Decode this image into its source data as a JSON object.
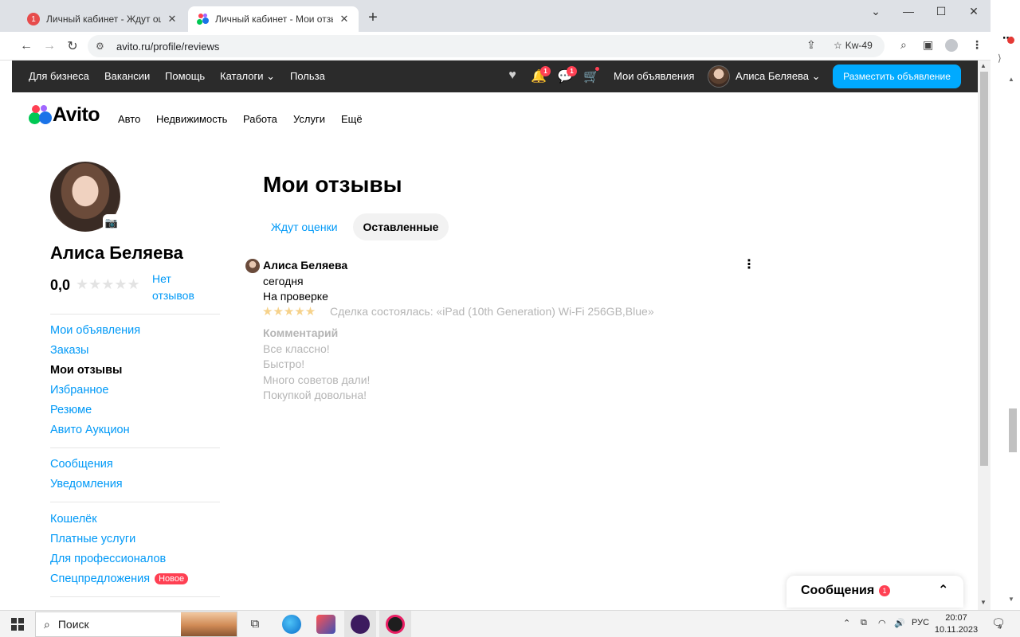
{
  "browser": {
    "tabs": [
      {
        "title": "Личный кабинет - Ждут оценки",
        "badge": "1",
        "active": false
      },
      {
        "title": "Личный кабинет - Мои отзывы",
        "active": true
      }
    ],
    "url": "avito.ru/profile/reviews",
    "profile_label": "Kw-49"
  },
  "topbar": {
    "links": [
      "Для бизнеса",
      "Вакансии",
      "Помощь",
      "Каталоги",
      "Польза"
    ],
    "notifications_count": "1",
    "messages_count": "1",
    "my_ads": "Мои объявления",
    "user_name": "Алиса Беляева",
    "post_button": "Разместить объявление"
  },
  "header": {
    "logo": "Avito",
    "categories": [
      "Авто",
      "Недвижимость",
      "Работа",
      "Услуги",
      "Ещё"
    ]
  },
  "profile": {
    "name": "Алиса Беляева",
    "rating": "0,0",
    "no_reviews": "Нет отзывов",
    "menu_group1": [
      "Мои объявления",
      "Заказы",
      "Мои отзывы",
      "Избранное",
      "Резюме",
      "Авито Аукцион"
    ],
    "menu_group2": [
      "Сообщения",
      "Уведомления"
    ],
    "menu_group3": [
      "Кошелёк",
      "Платные услуги",
      "Для профессионалов",
      "Спецпредложения"
    ],
    "new_badge": "Новое"
  },
  "main": {
    "title": "Мои отзывы",
    "tabs": [
      "Ждут оценки",
      "Оставленные"
    ],
    "review": {
      "author": "Алиса Беляева",
      "date": "сегодня",
      "status": "На проверке",
      "stars": 5,
      "deal": "Сделка состоялась: «iPad (10th Generation) Wi-Fi 256GB,Blue»",
      "comment_heading": "Комментарий",
      "comment_lines": [
        "Все классно!",
        "Быстро!",
        "Много советов дали!",
        "Покупкой довольна!"
      ]
    }
  },
  "messages_widget": {
    "label": "Сообщения",
    "count": "1"
  },
  "taskbar": {
    "search_label": "Поиск",
    "language": "РУС",
    "time": "20:07",
    "date": "10.11.2023",
    "notification_count": "4"
  },
  "colors": {
    "accent_blue": "#0099f7",
    "button_blue": "#00aaff",
    "badge_red": "#ff4053",
    "topbar_bg": "#2b2b2b",
    "star_gold": "#f6d28b"
  }
}
